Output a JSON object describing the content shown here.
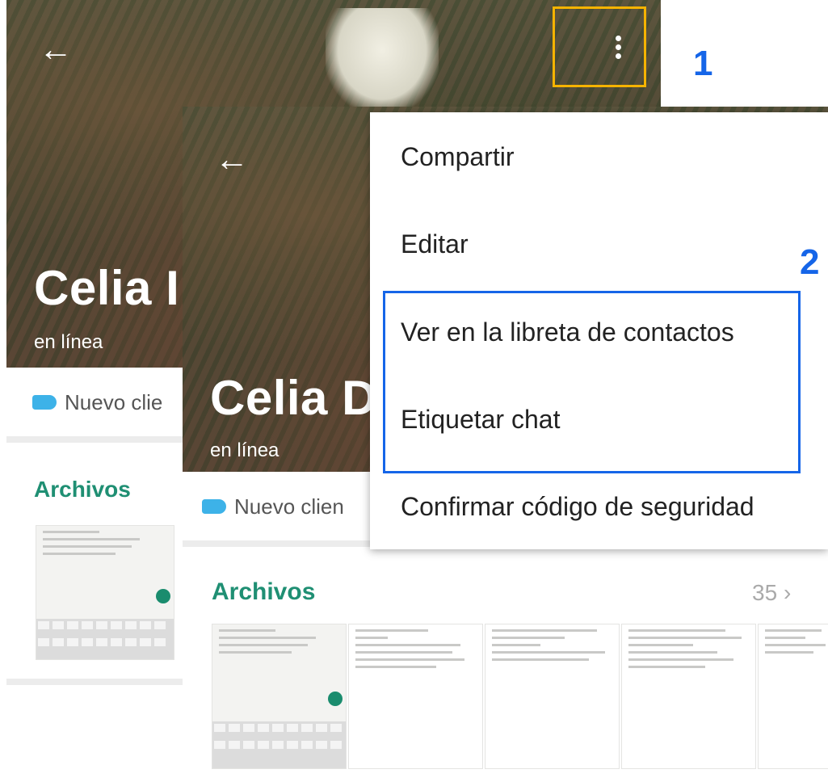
{
  "background_screen": {
    "contact_name": "Celia I",
    "status": "en línea",
    "label": "Nuevo clie",
    "files_title": "Archivos"
  },
  "front_screen": {
    "contact_name": "Celia D",
    "status": "en línea",
    "label": "Nuevo clien",
    "files_title": "Archivos",
    "files_count": "35"
  },
  "menu": {
    "items": [
      "Compartir",
      "Editar",
      "Ver en la libreta de contactos",
      "Etiquetar chat",
      "Confirmar código de seguridad"
    ]
  },
  "annotations": {
    "step1": "1",
    "step2": "2",
    "highlight_colors": {
      "step1": "#f5b300",
      "step2": "#1565e8"
    }
  },
  "icons": [
    "back-arrow-icon",
    "more-vert-icon",
    "label-icon",
    "chevron-right-icon"
  ]
}
